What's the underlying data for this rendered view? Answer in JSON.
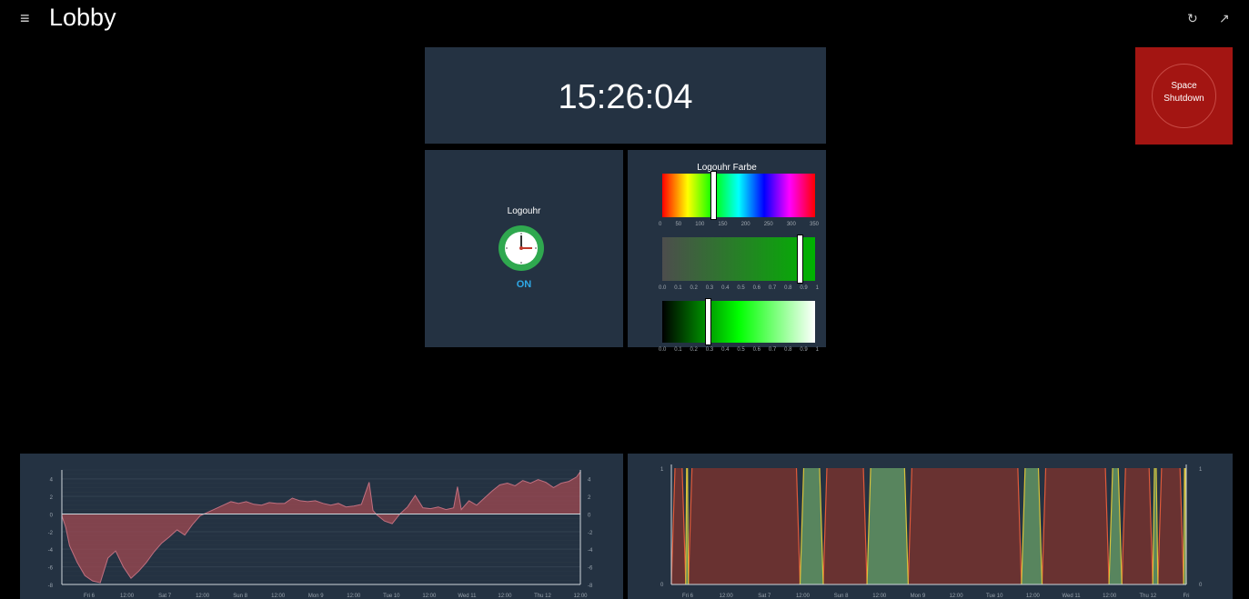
{
  "header": {
    "menu_icon": "hamburger-icon",
    "title": "Lobby",
    "refresh_icon": "refresh-icon",
    "fullscreen_icon": "expand-icon"
  },
  "clock": {
    "time": "15:26:04"
  },
  "switch": {
    "label": "Logouhr",
    "state": "ON",
    "state_color": "#2ea8e6",
    "icon": "clock-icon"
  },
  "color_picker": {
    "title": "Logouhr Farbe",
    "hue": {
      "value": 120,
      "ticks": [
        "0",
        "50",
        "100",
        "150",
        "200",
        "250",
        "300",
        "350"
      ]
    },
    "saturation": {
      "value": 0.9,
      "ticks": [
        "0.0",
        "0.1",
        "0.2",
        "0.3",
        "0.4",
        "0.5",
        "0.6",
        "0.7",
        "0.8",
        "0.9",
        "1"
      ]
    },
    "lightness": {
      "value": 0.3,
      "ticks": [
        "0.0",
        "0.1",
        "0.2",
        "0.3",
        "0.4",
        "0.5",
        "0.6",
        "0.7",
        "0.8",
        "0.9",
        "1"
      ]
    }
  },
  "shutdown_button": {
    "line1": "Space",
    "line2": "Shutdown",
    "color": "#a31512"
  },
  "chart_data": [
    {
      "type": "area",
      "y_ticks": [
        "4",
        "2",
        "0",
        "-2",
        "-4",
        "-6",
        "-8"
      ],
      "x_ticks": [
        "Fri 6",
        "12:00",
        "Sat 7",
        "12:00",
        "Sun 8",
        "12:00",
        "Mon 9",
        "12:00",
        "Tue 10",
        "12:00",
        "Wed 11",
        "12:00",
        "Thu 12",
        "12:00"
      ],
      "ylim": [
        -8,
        5
      ],
      "grid": true,
      "series": [
        {
          "color": "#a04a52",
          "x": [
            0,
            0.5,
            1,
            2,
            3,
            4,
            5,
            6,
            7,
            8,
            9,
            10,
            11,
            12,
            13,
            14,
            15,
            16,
            17,
            18,
            19,
            20,
            21,
            22,
            23,
            24,
            25,
            26,
            27,
            28,
            29,
            30,
            31,
            32,
            33,
            34,
            35,
            36,
            37,
            38,
            39,
            40,
            40.5,
            41,
            42,
            43,
            44,
            45,
            46,
            47,
            48,
            49,
            50,
            51,
            51.5,
            52,
            53,
            54,
            55,
            56,
            57,
            58,
            59,
            60,
            61,
            62,
            63,
            64,
            65,
            66,
            67,
            67.5
          ],
          "values": [
            -0.2,
            -1.5,
            -3.6,
            -5.5,
            -7,
            -7.6,
            -7.8,
            -5,
            -4.2,
            -6,
            -7.3,
            -6.5,
            -5.5,
            -4.3,
            -3.3,
            -2.6,
            -1.8,
            -2.4,
            -1.2,
            -0.2,
            0.2,
            0.6,
            1,
            1.4,
            1.2,
            1.4,
            1.1,
            1,
            1.3,
            1.2,
            1.2,
            1.8,
            1.5,
            1.4,
            1.5,
            1.2,
            1.0,
            1.2,
            0.8,
            0.9,
            1.1,
            3.6,
            0.4,
            -0.1,
            -0.8,
            -1.1,
            0,
            0.8,
            2.1,
            0.7,
            0.6,
            0.8,
            0.5,
            0.7,
            3.1,
            0.5,
            1.5,
            1.0,
            1.8,
            2.6,
            3.3,
            3.5,
            3.2,
            3.8,
            3.5,
            3.9,
            3.6,
            3.0,
            3.5,
            3.7,
            4.2,
            4.8
          ]
        }
      ]
    },
    {
      "type": "area",
      "y_ticks": [
        "1",
        "0"
      ],
      "x_ticks": [
        "Fri 6",
        "12:00",
        "Sat 7",
        "12:00",
        "Sun 8",
        "12:00",
        "Mon 9",
        "12:00",
        "Tue 10",
        "12:00",
        "Wed 11",
        "12:00",
        "Thu 12",
        "Fri"
      ],
      "ylim": [
        0,
        1
      ],
      "series": [
        {
          "color": "#6e3330",
          "segments": [
            [
              0,
              0.028
            ],
            [
              0.033,
              0.25
            ],
            [
              0.295,
              0.38
            ],
            [
              0.46,
              0.68
            ],
            [
              0.72,
              0.85
            ],
            [
              0.875,
              0.935
            ],
            [
              0.945,
              0.995
            ]
          ]
        },
        {
          "color": "#5c8a60",
          "segments": [
            [
              0.028,
              0.033
            ],
            [
              0.25,
              0.295
            ],
            [
              0.38,
              0.46
            ],
            [
              0.68,
              0.72
            ],
            [
              0.85,
              0.875
            ],
            [
              0.935,
              0.945
            ],
            [
              0.995,
              1
            ]
          ]
        }
      ]
    }
  ]
}
